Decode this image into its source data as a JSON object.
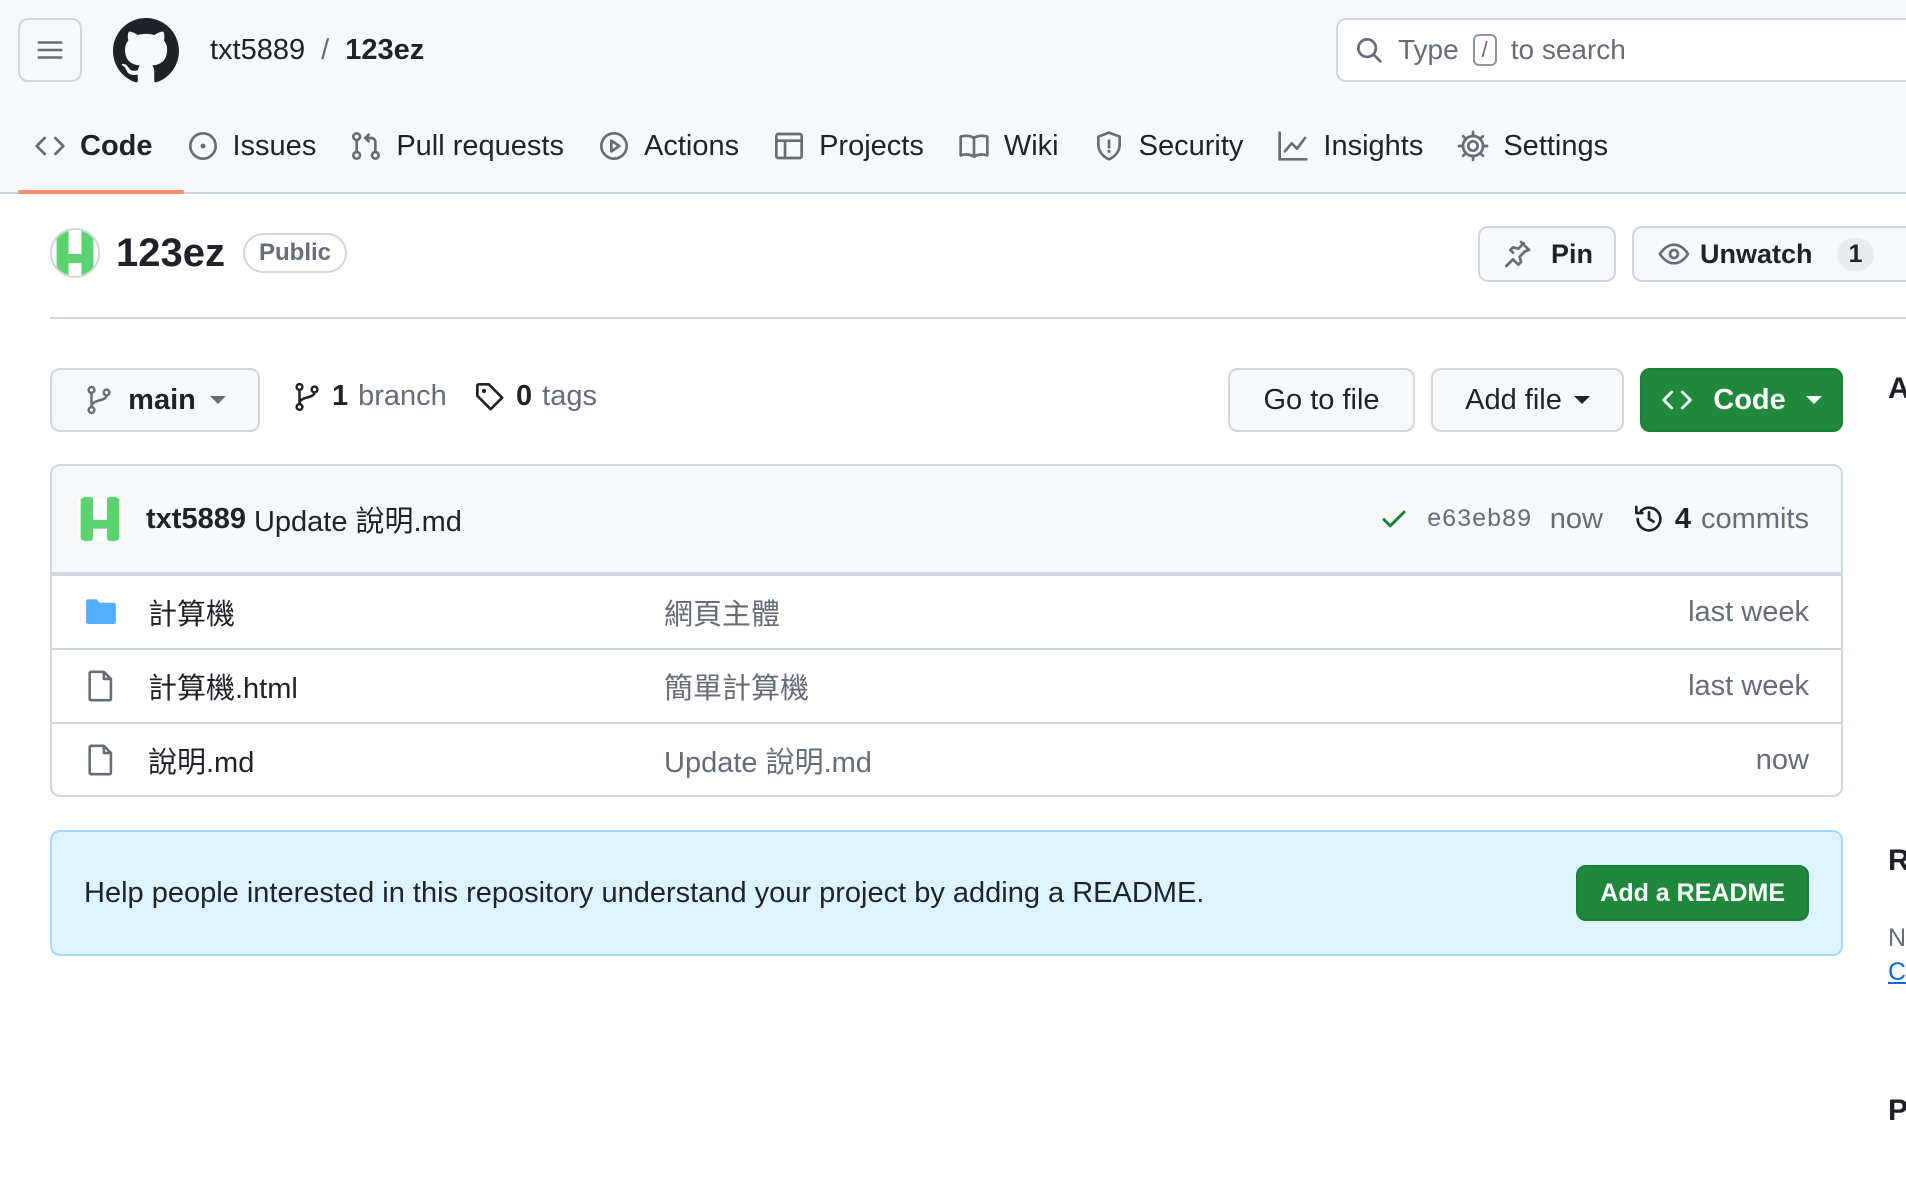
{
  "header": {
    "owner": "txt5889",
    "separator": "/",
    "repo": "123ez",
    "search_prefix": "Type",
    "search_key": "/",
    "search_suffix": "to search"
  },
  "tabs": [
    {
      "label": "Code",
      "icon": "code-icon",
      "active": true
    },
    {
      "label": "Issues",
      "icon": "issue-icon"
    },
    {
      "label": "Pull requests",
      "icon": "pull-request-icon"
    },
    {
      "label": "Actions",
      "icon": "play-icon"
    },
    {
      "label": "Projects",
      "icon": "table-icon"
    },
    {
      "label": "Wiki",
      "icon": "book-icon"
    },
    {
      "label": "Security",
      "icon": "shield-icon"
    },
    {
      "label": "Insights",
      "icon": "graph-icon"
    },
    {
      "label": "Settings",
      "icon": "gear-icon"
    }
  ],
  "repo_header": {
    "name": "123ez",
    "visibility": "Public",
    "pin_label": "Pin",
    "watch_label": "Unwatch",
    "watch_count": "1"
  },
  "toolbar": {
    "branch": "main",
    "branch_count": "1",
    "branch_word": "branch",
    "tag_count": "0",
    "tag_word": "tags",
    "go_to_file": "Go to file",
    "add_file": "Add file",
    "code": "Code"
  },
  "latest_commit": {
    "author": "txt5889",
    "message": "Update 說明.md",
    "sha": "e63eb89",
    "time": "now",
    "commit_count": "4",
    "commit_word": "commits"
  },
  "files": [
    {
      "type": "folder",
      "name": "計算機",
      "message": "網頁主體",
      "time": "last week"
    },
    {
      "type": "file",
      "name": "計算機.html",
      "message": "簡單計算機",
      "time": "last week"
    },
    {
      "type": "file",
      "name": "說明.md",
      "message": "Update 說明.md",
      "time": "now"
    }
  ],
  "readme_banner": {
    "text": "Help people interested in this repository understand your project by adding a README.",
    "button": "Add a README"
  },
  "sidebar_peek": {
    "about_initial": "A",
    "readme_initial": "R",
    "readme_line1": "N",
    "readme_link": "C",
    "packages_initial": "P"
  },
  "colors": {
    "accent_green": "#1f883d",
    "tab_underline": "#fd8c73",
    "banner_bg": "#ddf4ff",
    "folder_blue": "#54aeff"
  }
}
